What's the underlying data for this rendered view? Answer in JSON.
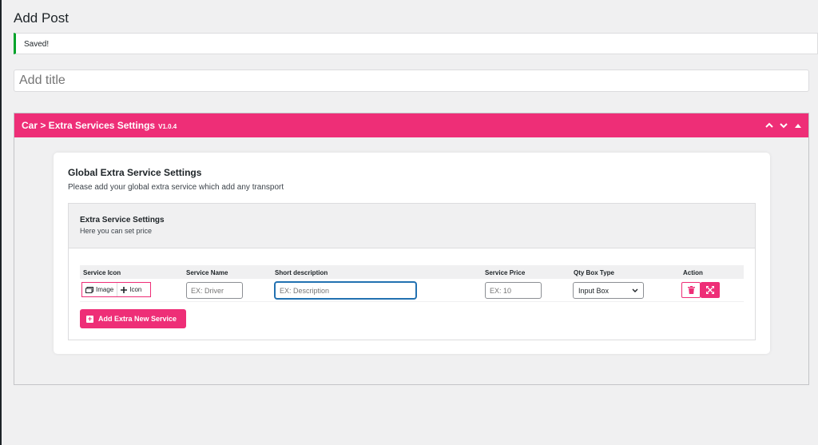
{
  "page": {
    "title": "Add Post"
  },
  "notice": {
    "text": "Saved!"
  },
  "post_title": {
    "placeholder": "Add title"
  },
  "metabox": {
    "title": "Car > Extra Services Settings",
    "version": "V1.0.4"
  },
  "card": {
    "title": "Global Extra Service Settings",
    "subtitle": "Please add your global extra service which add any transport"
  },
  "section": {
    "title": "Extra Service Settings",
    "subtitle": "Here you can set price"
  },
  "table": {
    "headers": {
      "icon": "Service Icon",
      "name": "Service Name",
      "desc": "Short description",
      "price": "Service Price",
      "qty": "Qty Box Type",
      "action": "Action"
    },
    "row": {
      "image_label": "Image",
      "icon_label": "Icon",
      "name_placeholder": "EX: Driver",
      "desc_placeholder": "EX: Description",
      "price_placeholder": "EX: 10",
      "qty_value": "Input Box"
    }
  },
  "add_button": {
    "label": "Add Extra New Service"
  },
  "colors": {
    "accent": "#ee2e77",
    "success": "#00a32a",
    "focus": "#2271b1"
  }
}
